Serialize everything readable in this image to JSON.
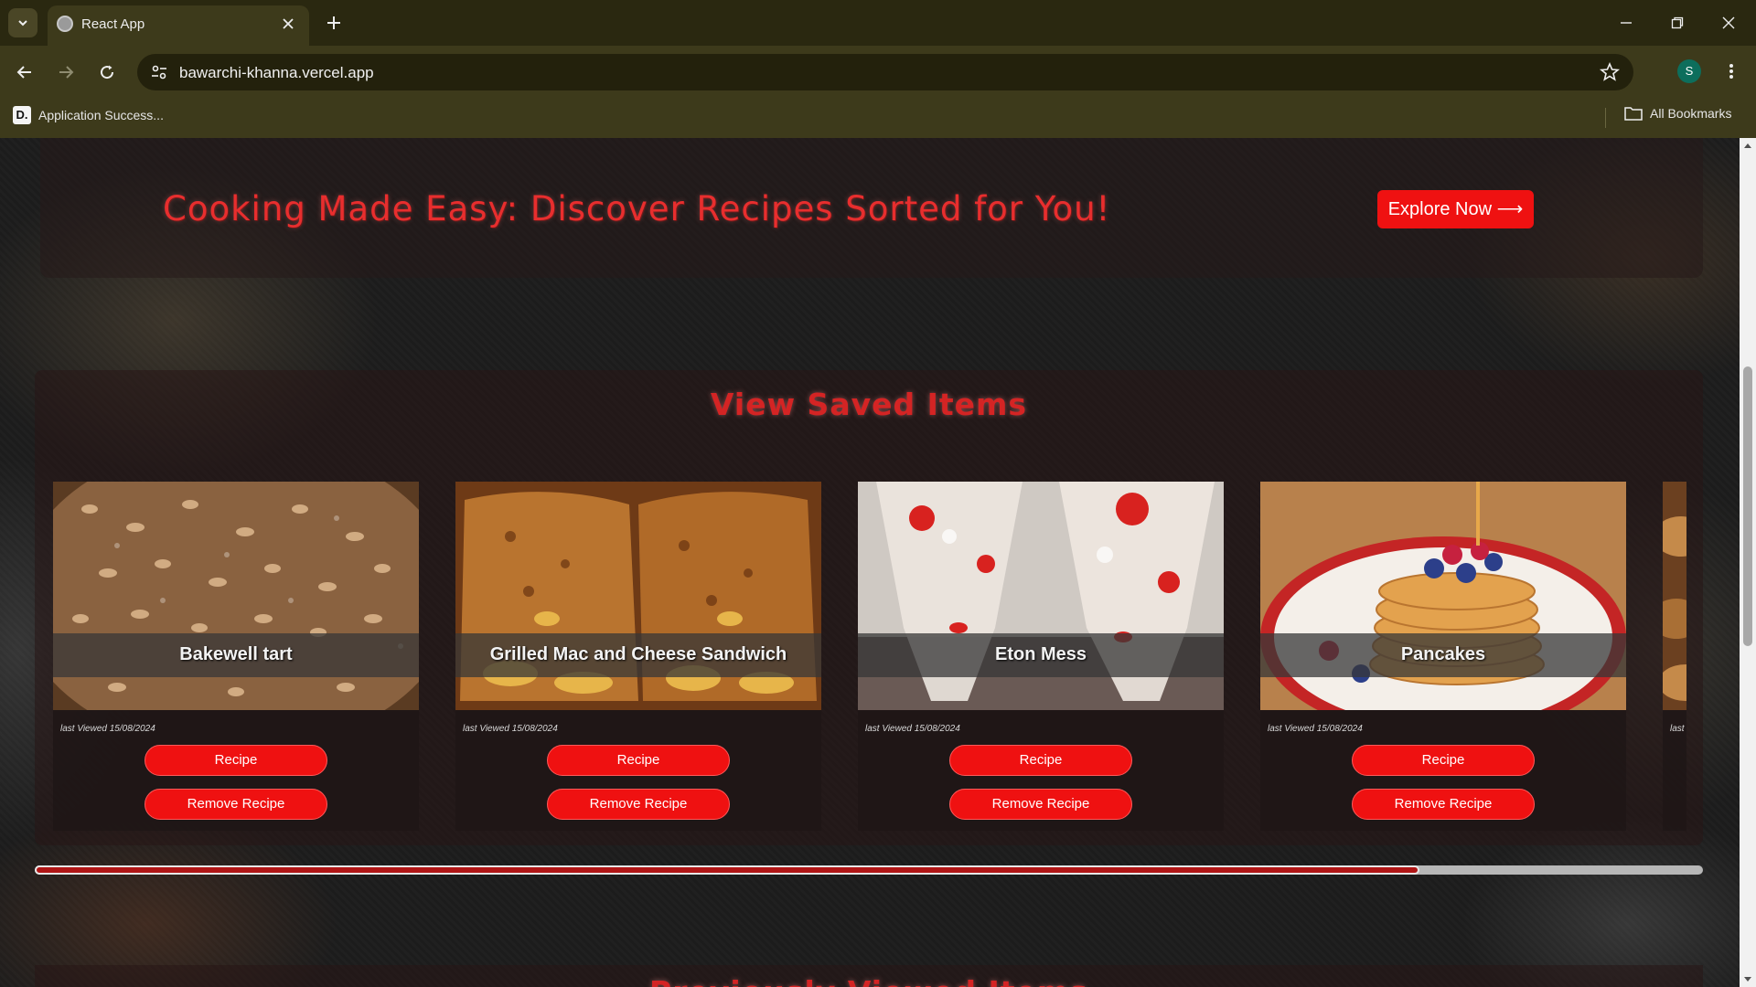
{
  "browser": {
    "tab_title": "React App",
    "url": "bawarchi-khanna.vercel.app",
    "profile_initial": "S",
    "bookmarks": [
      {
        "icon_text": "D.",
        "label": "Application Success..."
      }
    ],
    "all_bookmarks_label": "All Bookmarks"
  },
  "hero": {
    "title": "Cooking Made Easy: Discover Recipes Sorted for You!",
    "cta_label": "Explore Now ⟶"
  },
  "saved": {
    "title": "View Saved Items",
    "items": [
      {
        "name": "Bakewell tart",
        "last_viewed": "last Viewed 15/08/2024",
        "recipe_label": "Recipe",
        "remove_label": "Remove Recipe"
      },
      {
        "name": "Grilled Mac and Cheese Sandwich",
        "last_viewed": "last Viewed 15/08/2024",
        "recipe_label": "Recipe",
        "remove_label": "Remove Recipe"
      },
      {
        "name": "Eton Mess",
        "last_viewed": "last Viewed 15/08/2024",
        "recipe_label": "Recipe",
        "remove_label": "Remove Recipe"
      },
      {
        "name": "Pancakes",
        "last_viewed": "last Viewed 15/08/2024",
        "recipe_label": "Recipe",
        "remove_label": "Remove Recipe"
      },
      {
        "name": "",
        "last_viewed": "last Vie",
        "recipe_label": "",
        "remove_label": ""
      }
    ],
    "scroll_position": 0.83
  },
  "previous": {
    "title": "Previously Viewed Items"
  },
  "colors": {
    "accent": "#ef1111",
    "title_red": "#e82e2e",
    "chrome_bg": "#3d3a1b"
  }
}
